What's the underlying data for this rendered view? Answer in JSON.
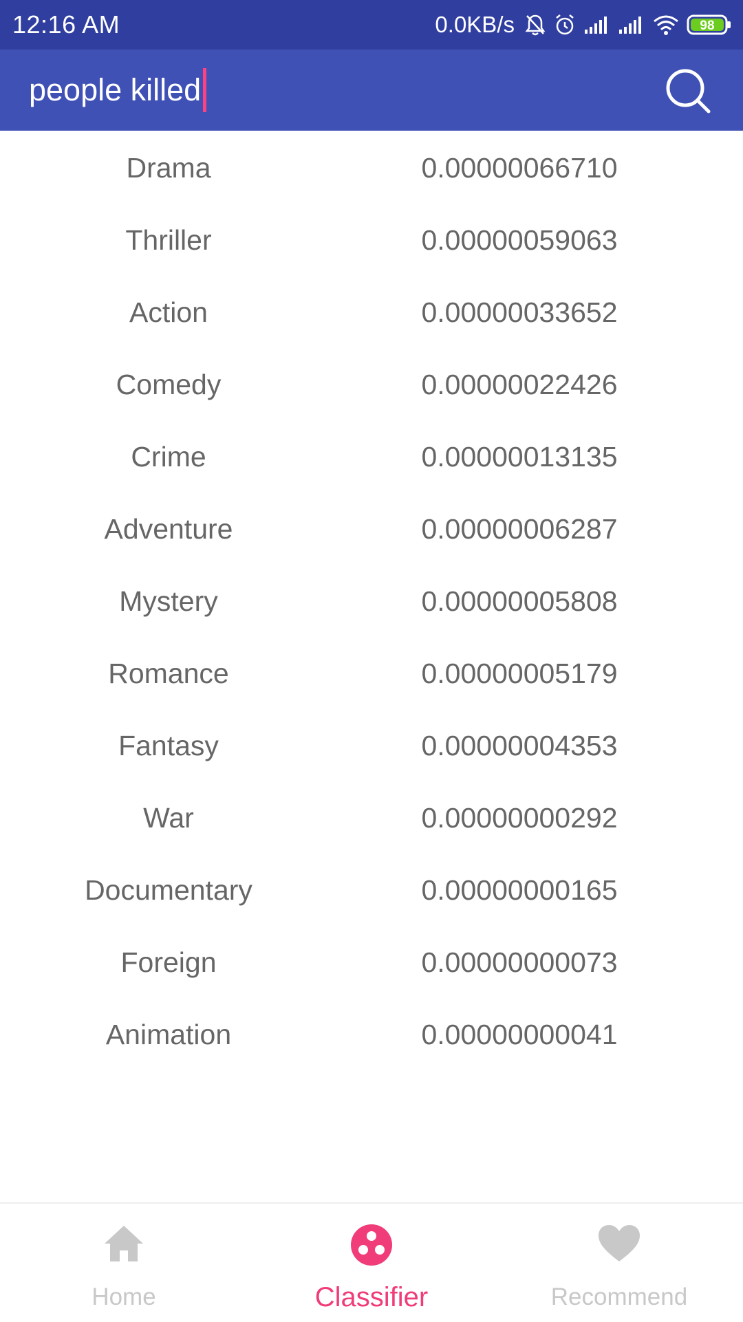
{
  "status_bar": {
    "time": "12:16  AM",
    "network_speed": "0.0KB/s",
    "battery_level": "98",
    "icons": [
      "bell-muted-icon",
      "alarm-icon",
      "signal-icon",
      "signal-icon",
      "wifi-icon",
      "battery-icon"
    ]
  },
  "search": {
    "query": "people killed",
    "icon": "search-icon"
  },
  "genres": [
    {
      "name": "Drama",
      "score": "0.00000066710"
    },
    {
      "name": "Thriller",
      "score": "0.00000059063"
    },
    {
      "name": "Action",
      "score": "0.00000033652"
    },
    {
      "name": "Comedy",
      "score": "0.00000022426"
    },
    {
      "name": "Crime",
      "score": "0.00000013135"
    },
    {
      "name": "Adventure",
      "score": "0.00000006287"
    },
    {
      "name": "Mystery",
      "score": "0.00000005808"
    },
    {
      "name": "Romance",
      "score": "0.00000005179"
    },
    {
      "name": "Fantasy",
      "score": "0.00000004353"
    },
    {
      "name": "War",
      "score": "0.00000000292"
    },
    {
      "name": "Documentary",
      "score": "0.00000000165"
    },
    {
      "name": "Foreign",
      "score": "0.00000000073"
    },
    {
      "name": "Animation",
      "score": "0.00000000041"
    }
  ],
  "bottom_nav": {
    "items": [
      {
        "label": "Home",
        "icon": "home-icon",
        "active": false
      },
      {
        "label": "Classifier",
        "icon": "classifier-icon",
        "active": true
      },
      {
        "label": "Recommend",
        "icon": "heart-icon",
        "active": false
      }
    ]
  },
  "colors": {
    "status_bar": "#303f9f",
    "toolbar": "#3f51b5",
    "accent": "#f03c79",
    "cursor": "#ff4081",
    "list_text": "#666666",
    "nav_inactive": "#c8c8c8",
    "battery_fill": "#6ccc1f"
  }
}
